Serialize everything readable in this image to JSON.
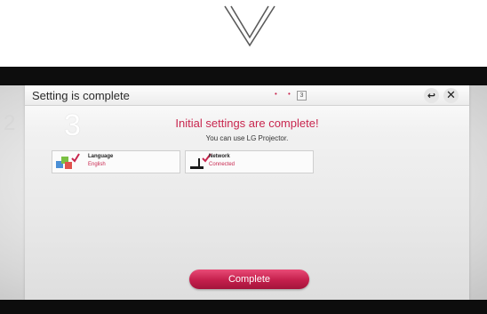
{
  "header": {
    "title": "Setting is complete",
    "step_dots": "• •",
    "step_number": "3"
  },
  "steps": {
    "previous": "2",
    "current": "3"
  },
  "main": {
    "heading": "Initial settings are complete!",
    "subheading": "You can use LG Projector."
  },
  "cards": {
    "language": {
      "title": "Language",
      "value": "English",
      "icon": "language-icon"
    },
    "network": {
      "title": "Network",
      "value": "Connected",
      "icon": "network-icon"
    }
  },
  "buttons": {
    "complete": "Complete",
    "back_icon": "back-icon",
    "close_icon": "close-icon"
  },
  "colors": {
    "accent": "#c8264e",
    "frame": "#0d0d0d"
  }
}
